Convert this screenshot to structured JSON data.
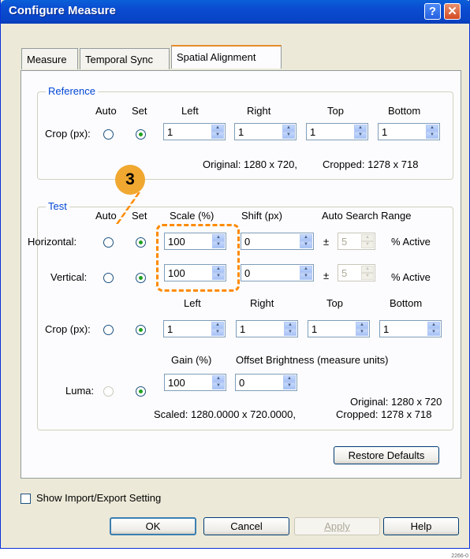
{
  "window": {
    "title": "Configure Measure"
  },
  "tabs": [
    "Measure",
    "Temporal Sync",
    "Spatial Alignment"
  ],
  "reference": {
    "legend": "Reference",
    "col_auto": "Auto",
    "col_set": "Set",
    "col_left": "Left",
    "col_right": "Right",
    "col_top": "Top",
    "col_bottom": "Bottom",
    "crop_label": "Crop (px):",
    "crop": [
      "1",
      "1",
      "1",
      "1"
    ],
    "original": "Original: 1280 x 720,",
    "cropped": "Cropped: 1278 x 718"
  },
  "test": {
    "legend": "Test",
    "col_auto": "Auto",
    "col_set": "Set",
    "col_scale": "Scale (%)",
    "col_shift": "Shift (px)",
    "col_auto_search": "Auto Search Range",
    "horizontal_label": "Horizontal:",
    "vertical_label": "Vertical:",
    "h_scale": "100",
    "h_shift": "0",
    "h_range": "5",
    "v_scale": "100",
    "v_shift": "0",
    "v_range": "5",
    "plusminus": "±",
    "active": "% Active",
    "col_left": "Left",
    "col_right": "Right",
    "col_top": "Top",
    "col_bottom": "Bottom",
    "crop_label": "Crop (px):",
    "crop": [
      "1",
      "1",
      "1",
      "1"
    ],
    "col_gain": "Gain (%)",
    "col_offset": "Offset Brightness (measure units)",
    "luma_label": "Luma:",
    "gain": "100",
    "offset": "0",
    "original": "Original: 1280 x 720",
    "scaled": "Scaled: 1280.0000 x 720.0000,",
    "cropped": "Cropped: 1278 x 718"
  },
  "buttons": {
    "restore": "Restore Defaults",
    "ok": "OK",
    "cancel": "Cancel",
    "apply": "Apply",
    "help": "Help"
  },
  "show_import_export": "Show Import/Export Setting",
  "callout_number": "3",
  "figure_id": "2266-0"
}
